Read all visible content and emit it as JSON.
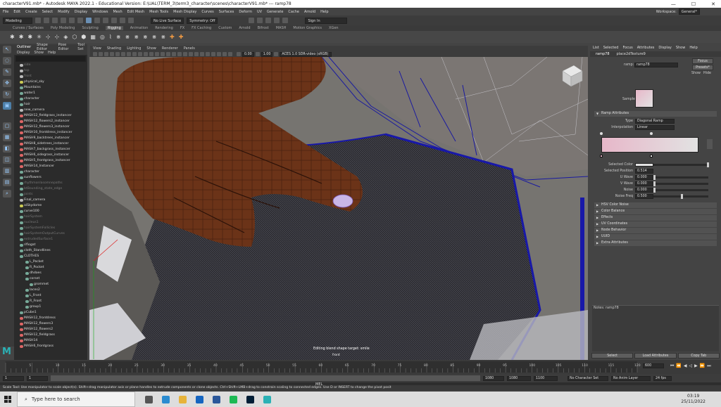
{
  "titlebar": {
    "title": "characterV91.mb* - Autodesk MAYA 2022.1 - Educational Version: E:\\UAL\\TERM_3\\term3_character\\scenes\\characterV91.mb* --- ramp78",
    "minimize": "—",
    "maximize": "☐",
    "close": "✕"
  },
  "menubar": {
    "items": [
      "File",
      "Edit",
      "Create",
      "Select",
      "Modify",
      "Display",
      "Windows",
      "Mesh",
      "Edit Mesh",
      "Mesh Tools",
      "Mesh Display",
      "Curves",
      "Surfaces",
      "Deform",
      "UV",
      "Generate",
      "Cache",
      "Arnold",
      "Help"
    ],
    "workspace_label": "Workspace:",
    "workspace_value": "General*"
  },
  "statusline": {
    "mode": "Modeling",
    "live": "No Live Surface",
    "symmetry": "Symmetry: Off",
    "signin": "Sign In"
  },
  "shelf": {
    "tabs": [
      "Curves / Surfaces",
      "Poly Modeling",
      "Sculpting",
      "Rigging",
      "Animation",
      "Rendering",
      "FX",
      "FX Caching",
      "Custom",
      "Arnold",
      "Bifrost",
      "MASH",
      "Motion Graphics",
      "XGen"
    ],
    "active": "Rigging"
  },
  "outliner": {
    "tabs": [
      "Outliner",
      "Shape Editor",
      "Pose Editor",
      "Tool Set"
    ],
    "menu": [
      "Display",
      "Show",
      "Help"
    ],
    "items": [
      {
        "label": "side",
        "dim": true,
        "c": "g"
      },
      {
        "label": "top",
        "dim": true,
        "c": "g"
      },
      {
        "label": "front",
        "dim": true,
        "c": "g"
      },
      {
        "label": "physical_sky",
        "dim": false,
        "c": "y"
      },
      {
        "label": "Mountains",
        "dim": false,
        "c": ""
      },
      {
        "label": "water1",
        "dim": false,
        "c": ""
      },
      {
        "label": "character",
        "dim": false,
        "c": ""
      },
      {
        "label": "hair",
        "dim": false,
        "c": ""
      },
      {
        "label": "new_camera",
        "dim": false,
        "c": "g"
      },
      {
        "label": "MASH12_fieldgrass_instancer",
        "dim": false,
        "c": "pk"
      },
      {
        "label": "MASH12_flowers2_instancer",
        "dim": false,
        "c": "pk"
      },
      {
        "label": "MASH12_flowers3_instancer",
        "dim": false,
        "c": "pk"
      },
      {
        "label": "MASH10_frontdress_instancer",
        "dim": false,
        "c": "pk"
      },
      {
        "label": "MASH9_backtrees_instancer",
        "dim": false,
        "c": "pk"
      },
      {
        "label": "MASH8_sidetrees_instancer",
        "dim": false,
        "c": "pk"
      },
      {
        "label": "MASH7_backgrass_instancer",
        "dim": false,
        "c": "pk"
      },
      {
        "label": "MASH6_sidegrass_instancer",
        "dim": false,
        "c": "pk"
      },
      {
        "label": "MASH5_frontgrass_instancer",
        "dim": false,
        "c": "pk"
      },
      {
        "label": "MASH14_Instancer",
        "dim": false,
        "c": "pk"
      },
      {
        "label": "character",
        "dim": false,
        "c": ""
      },
      {
        "label": "sunflowers",
        "dim": false,
        "c": ""
      },
      {
        "label": "rhythmonlasomnepaths",
        "dim": true,
        "c": ""
      },
      {
        "label": "btBounding_state_edge",
        "dim": true,
        "c": ""
      },
      {
        "label": "joints",
        "dim": true,
        "c": ""
      },
      {
        "label": "Final_camera",
        "dim": false,
        "c": "g"
      },
      {
        "label": "aiSkydome",
        "dim": false,
        "c": "y"
      },
      {
        "label": "curve100",
        "dim": false,
        "c": ""
      },
      {
        "label": "hairSystem",
        "dim": true,
        "c": ""
      },
      {
        "label": "nucleus1",
        "dim": true,
        "c": ""
      },
      {
        "label": "hairSystemFollicles",
        "dim": true,
        "c": ""
      },
      {
        "label": "hairSystemOutputCurves",
        "dim": true,
        "c": ""
      },
      {
        "label": "extrudedSurface1",
        "dim": true,
        "c": ""
      },
      {
        "label": "rifiogat",
        "dim": false,
        "c": ""
      },
      {
        "label": "cloth_Standlines",
        "dim": false,
        "c": ""
      },
      {
        "label": "CLOTHES",
        "dim": false,
        "c": ""
      },
      {
        "label": "L_Pocket",
        "dim": false,
        "c": "",
        "ind": 1
      },
      {
        "label": "R_Pocket",
        "dim": false,
        "c": "",
        "ind": 1
      },
      {
        "label": "dhdoes",
        "dim": false,
        "c": "",
        "ind": 1
      },
      {
        "label": "corset",
        "dim": false,
        "c": "",
        "ind": 1
      },
      {
        "label": "grommet",
        "dim": false,
        "c": "",
        "ind": 2
      },
      {
        "label": "laces2",
        "dim": false,
        "c": "",
        "ind": 1
      },
      {
        "label": "L_Front",
        "dim": false,
        "c": "",
        "ind": 1
      },
      {
        "label": "R_Front",
        "dim": false,
        "c": "",
        "ind": 1
      },
      {
        "label": "group1",
        "dim": false,
        "c": "",
        "ind": 1
      },
      {
        "label": "pCube1",
        "dim": false,
        "c": ""
      },
      {
        "label": "MASH12_frontdress",
        "dim": false,
        "c": "pk"
      },
      {
        "label": "MASH12_flowers3",
        "dim": false,
        "c": "pk"
      },
      {
        "label": "MASH12_flowers2",
        "dim": false,
        "c": "pk"
      },
      {
        "label": "MASH12_fieldgrass",
        "dim": false,
        "c": "pk"
      },
      {
        "label": "MASH14",
        "dim": false,
        "c": "pk"
      },
      {
        "label": "MASH6_frontgrass",
        "dim": false,
        "c": "pk"
      }
    ]
  },
  "viewport": {
    "menu": [
      "View",
      "Shading",
      "Lighting",
      "Show",
      "Renderer",
      "Panels"
    ],
    "exposure": "0.00",
    "gamma": "1.00",
    "colorspace": "ACES 1.0 SDR-video (sRGB)",
    "status": "Editing blend shape target: smile",
    "camera": "front"
  },
  "attribute_editor": {
    "menu": [
      "List",
      "Selected",
      "Focus",
      "Attributes",
      "Display",
      "Show",
      "Help"
    ],
    "tabs": [
      "ramp78",
      "place2dTexture9"
    ],
    "ramp_label": "ramp:",
    "ramp_value": "ramp78",
    "focus": "Focus",
    "presets": "Presets*",
    "show": "Show",
    "hide": "Hide",
    "sample_label": "Sample",
    "section_open": "Ramp Attributes",
    "type_label": "Type",
    "type_value": "Diagonal Ramp",
    "interp_label": "Interpolation",
    "interp_value": "Linear",
    "selected_color_label": "Selected Color",
    "selected_position_label": "Selected Position",
    "selected_position": "0.514",
    "u_wave_label": "U Wave",
    "u_wave": "0.000",
    "u_wave_frac": 0.0,
    "v_wave_label": "V Wave",
    "v_wave": "0.000",
    "v_wave_frac": 0.0,
    "noise_label": "Noise",
    "noise": "0.000",
    "noise_frac": 0.0,
    "noise_freq_label": "Noise Freq",
    "noise_freq": "0.500",
    "noise_freq_frac": 0.5,
    "sections": [
      "HSV Color Noise",
      "Color Balance",
      "Effects",
      "UV Coordinates",
      "Node Behavior",
      "UUID",
      "Extra Attributes"
    ],
    "notes": "Notes:  ramp78",
    "select": "Select",
    "load": "Load Attributes",
    "copy": "Copy Tab",
    "ramp_color_left": "#e7b7c9",
    "ramp_color_right": "#e2e2e2"
  },
  "timeline": {
    "ticks": [
      "5",
      "10",
      "15",
      "20",
      "25",
      "30",
      "35",
      "40",
      "45",
      "50",
      "55",
      "60",
      "65",
      "70",
      "75",
      "80",
      "85",
      "90",
      "95",
      "100",
      "105",
      "110",
      "115",
      "120"
    ],
    "current": "600",
    "range_start": "1",
    "range_start2": "1",
    "range_end": "1080",
    "range_end2": "1080",
    "range_end3": "1100",
    "char_set": "No Character Set",
    "anim_layer": "No Anim Layer",
    "fps": "24 fps"
  },
  "cmd": {
    "label": "MEL",
    "help": "Scale Tool: Use manipulator to scale object(s). Shift+drag manipulator axis or plane handles to extrude components or clone objects. Ctrl+Shift+LMB+drag to constrain scaling to connected edges. Use D or INSERT to change the pivot posit"
  },
  "taskbar": {
    "search": "Type here to search",
    "time": "03:19",
    "date": "25/11/2022",
    "apps": [
      {
        "icon": "task-view-icon",
        "color": "#555"
      },
      {
        "icon": "edge-icon",
        "color": "#2a8bd0"
      },
      {
        "icon": "explorer-icon",
        "color": "#e7b33a"
      },
      {
        "icon": "outlook-icon",
        "color": "#1565c0"
      },
      {
        "icon": "word-icon",
        "color": "#2b579a"
      },
      {
        "icon": "spotify-icon",
        "color": "#1db954"
      },
      {
        "icon": "photoshop-icon",
        "color": "#001e36"
      },
      {
        "icon": "maya-icon",
        "color": "#2bb1b5"
      }
    ]
  }
}
